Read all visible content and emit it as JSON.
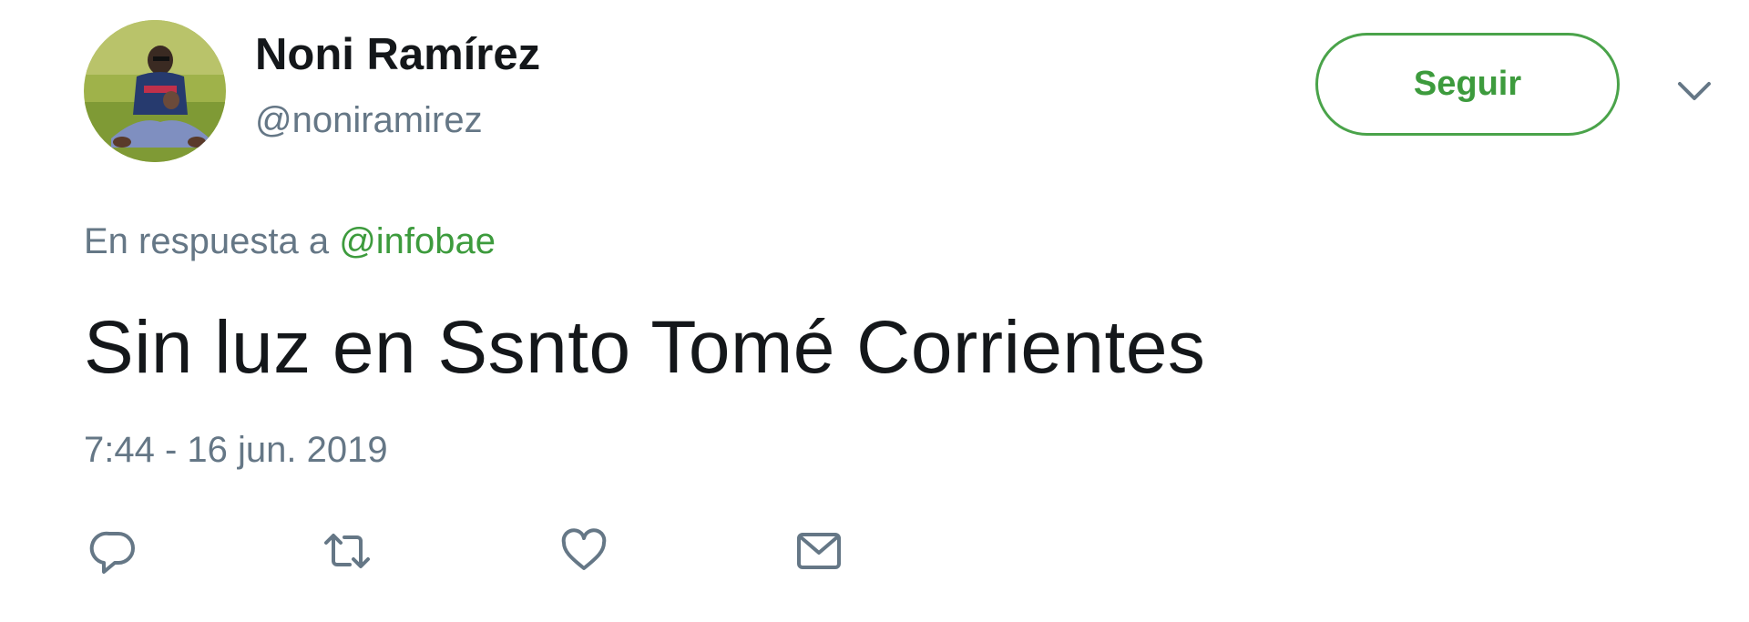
{
  "tweet": {
    "author": {
      "display_name": "Noni Ramírez",
      "handle": "@noniramirez"
    },
    "follow_label": "Seguir",
    "reply_context": {
      "prefix": "En respuesta a ",
      "mention": "@infobae"
    },
    "text": "Sin luz en Ssnto Tomé Corrientes",
    "timestamp": "7:44 - 16 jun. 2019",
    "actions": [
      {
        "icon": "reply-icon"
      },
      {
        "icon": "retweet-icon"
      },
      {
        "icon": "like-icon"
      },
      {
        "icon": "direct-message-icon"
      }
    ]
  },
  "colors": {
    "accent": "#3d9b3d",
    "text_primary": "#14171a",
    "text_secondary": "#657786",
    "icon": "#657786"
  }
}
